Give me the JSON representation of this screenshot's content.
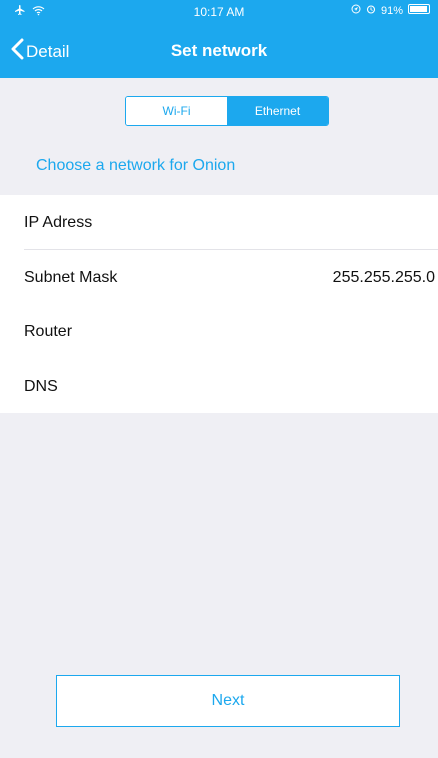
{
  "status_bar": {
    "time": "10:17 AM",
    "battery": "91%",
    "icons": [
      "airplane-icon",
      "wifi-icon",
      "location-icon",
      "alarm-icon",
      "battery-icon"
    ]
  },
  "nav": {
    "back_label": "Detail",
    "title": "Set network"
  },
  "segments": {
    "wifi_label": "Wi-Fi",
    "ethernet_label": "Ethernet",
    "selected": "Ethernet"
  },
  "section_header": "Choose a network for Onion",
  "network": {
    "rows": [
      {
        "label": "IP Adress",
        "value": ""
      },
      {
        "label": "Subnet Mask",
        "value": "255.255.255.0"
      },
      {
        "label": "Router",
        "value": ""
      },
      {
        "label": "DNS",
        "value": ""
      }
    ]
  },
  "next_label": "Next",
  "colors": {
    "accent": "#1ca8ee",
    "background": "#efeff4",
    "surface": "#ffffff"
  }
}
